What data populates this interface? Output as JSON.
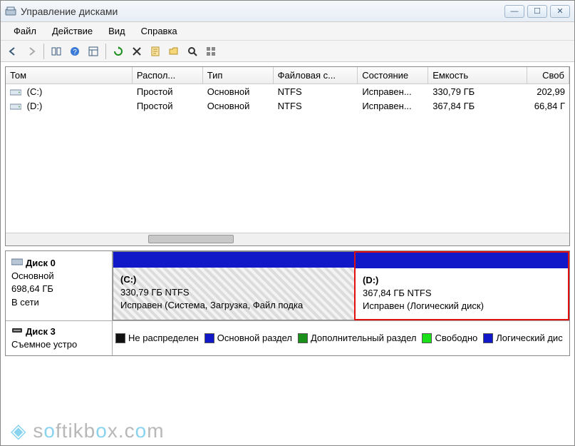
{
  "title": "Управление дисками",
  "menu": [
    "Файл",
    "Действие",
    "Вид",
    "Справка"
  ],
  "columns": {
    "volume": "Том",
    "layout": "Распол...",
    "type": "Тип",
    "fs": "Файловая с...",
    "status": "Состояние",
    "capacity": "Емкость",
    "free": "Своб"
  },
  "volumes": [
    {
      "name": "(C:)",
      "layout": "Простой",
      "type": "Основной",
      "fs": "NTFS",
      "status": "Исправен...",
      "capacity": "330,79 ГБ",
      "free": "202,99"
    },
    {
      "name": "(D:)",
      "layout": "Простой",
      "type": "Основной",
      "fs": "NTFS",
      "status": "Исправен...",
      "capacity": "367,84 ГБ",
      "free": "66,84 Г"
    }
  ],
  "disks": [
    {
      "name": "Диск 0",
      "type": "Основной",
      "size": "698,64 ГБ",
      "state": "В сети",
      "partitions": [
        {
          "label": "(C:)",
          "info": "330,79 ГБ NTFS",
          "status": "Исправен (Система, Загрузка, Файл подка",
          "kind": "primary"
        },
        {
          "label": "(D:)",
          "info": "367,84 ГБ NTFS",
          "status": "Исправен (Логический диск)",
          "kind": "logical"
        }
      ]
    },
    {
      "name": "Диск 3",
      "type": "Съемное устро"
    }
  ],
  "legend": {
    "unalloc": "Не распределен",
    "primary": "Основной раздел",
    "extended": "Дополнительный раздел",
    "free": "Свободно",
    "logical": "Логический дис"
  },
  "watermark": "softikbox.com"
}
